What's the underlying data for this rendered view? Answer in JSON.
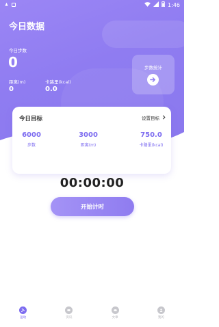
{
  "status": {
    "time": "1:46"
  },
  "header": {
    "title": "今日数据"
  },
  "today": {
    "steps_label": "今日步数",
    "steps_value": "0",
    "distance_label": "距离(m)",
    "distance_value": "0",
    "calories_label": "卡路里(kcal)",
    "calories_value": "0.0"
  },
  "stats_card": {
    "label": "步数统计"
  },
  "goal": {
    "title": "今日目标",
    "set_label": "设置目标",
    "items": [
      {
        "value": "6000",
        "unit": "步数"
      },
      {
        "value": "3000",
        "unit": "距离(m)"
      },
      {
        "value": "750.0",
        "unit": "卡路里(kcal)"
      }
    ]
  },
  "timer": {
    "value": "00:00:00",
    "start_label": "开始计时"
  },
  "tabbar": {
    "items": [
      {
        "label": "运动"
      },
      {
        "label": "资讯"
      },
      {
        "label": "文章"
      },
      {
        "label": "我的"
      }
    ]
  },
  "colors": {
    "accent": "#7d6cf0",
    "hero": "#8f7cf1"
  }
}
